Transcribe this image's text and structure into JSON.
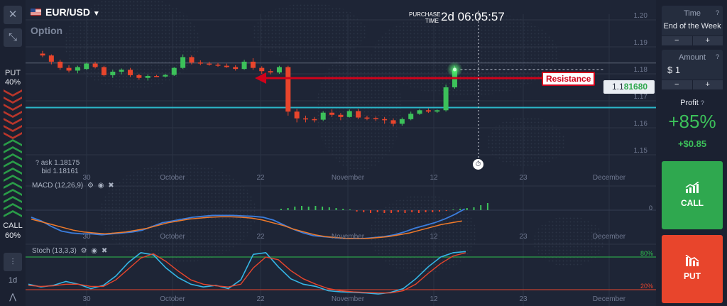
{
  "asset": {
    "name": "EUR/USD",
    "type": "Option"
  },
  "timer": {
    "label_line1": "PURCHASE",
    "label_line2": "TIME",
    "value": "2d 06:05:57"
  },
  "price": {
    "prefix": "1.1",
    "highlight": "81680"
  },
  "quote": {
    "ask": "ask 1.18175",
    "bid": "bid 1.18161"
  },
  "annotation": {
    "label": "Resistance",
    "color": "#d0021b"
  },
  "sentiment": {
    "put_label": "PUT",
    "put_pct": "40%",
    "call_label": "CALL",
    "call_pct": "60%",
    "put_share": 0.4,
    "call_share": 0.6
  },
  "left_toolbar": {
    "close_icon": "close-icon",
    "collapse_icon": "collapse-arrows-icon",
    "chart_type_icon": "candlestick-chart-icon",
    "timeframe": "1d",
    "draw_icon": "drawing-tool-icon"
  },
  "indicators": {
    "macd": {
      "label": "MACD (12,26,9)",
      "zero_label": "0",
      "icons": [
        "gear-icon",
        "eye-icon",
        "close-icon"
      ]
    },
    "stoch": {
      "label": "Stoch (13,3,3)",
      "upper_label": "80%",
      "lower_label": "20%",
      "icons": [
        "gear-icon",
        "eye-icon",
        "close-icon"
      ]
    }
  },
  "right_panel": {
    "time_label": "Time",
    "time_value": "End of the Week",
    "amount_label": "Amount",
    "amount_value": "$ 1",
    "stepper_minus": "−",
    "stepper_plus": "+",
    "profit_label": "Profit",
    "profit_pct": "+85%",
    "profit_value": "+$0.85",
    "call_label": "CALL",
    "put_label": "PUT",
    "call_color": "#2fa84f",
    "put_color": "#e8452c"
  },
  "chart_data": {
    "type": "candlestick",
    "y_ticks": [
      "1.20",
      "1.19",
      "1.18",
      "1.17",
      "1.16",
      "1.15"
    ],
    "x_ticks": [
      "30",
      "October",
      "22",
      "November",
      "12",
      "23",
      "December"
    ],
    "ylim": [
      1.15,
      1.2
    ],
    "candles": [
      {
        "o": 1.1875,
        "h": 1.1885,
        "l": 1.1862,
        "c": 1.1868
      },
      {
        "o": 1.1868,
        "h": 1.1872,
        "l": 1.1835,
        "c": 1.1845
      },
      {
        "o": 1.1845,
        "h": 1.1852,
        "l": 1.1815,
        "c": 1.1822
      },
      {
        "o": 1.1822,
        "h": 1.1832,
        "l": 1.1805,
        "c": 1.1812
      },
      {
        "o": 1.1812,
        "h": 1.183,
        "l": 1.1802,
        "c": 1.1825
      },
      {
        "o": 1.1818,
        "h": 1.1842,
        "l": 1.1815,
        "c": 1.1838
      },
      {
        "o": 1.1838,
        "h": 1.1845,
        "l": 1.182,
        "c": 1.1825
      },
      {
        "o": 1.1825,
        "h": 1.183,
        "l": 1.179,
        "c": 1.1795
      },
      {
        "o": 1.1795,
        "h": 1.1815,
        "l": 1.1785,
        "c": 1.1808
      },
      {
        "o": 1.1808,
        "h": 1.182,
        "l": 1.1798,
        "c": 1.1815
      },
      {
        "o": 1.1815,
        "h": 1.1822,
        "l": 1.1788,
        "c": 1.1795
      },
      {
        "o": 1.1795,
        "h": 1.18,
        "l": 1.1778,
        "c": 1.1785
      },
      {
        "o": 1.1785,
        "h": 1.1798,
        "l": 1.1775,
        "c": 1.1792
      },
      {
        "o": 1.1792,
        "h": 1.1796,
        "l": 1.1788,
        "c": 1.179
      },
      {
        "o": 1.179,
        "h": 1.18,
        "l": 1.1786,
        "c": 1.1796
      },
      {
        "o": 1.1796,
        "h": 1.1825,
        "l": 1.1792,
        "c": 1.1822
      },
      {
        "o": 1.1822,
        "h": 1.1872,
        "l": 1.1818,
        "c": 1.1862
      },
      {
        "o": 1.1862,
        "h": 1.1868,
        "l": 1.1835,
        "c": 1.1842
      },
      {
        "o": 1.1842,
        "h": 1.185,
        "l": 1.1832,
        "c": 1.1838
      },
      {
        "o": 1.1838,
        "h": 1.1845,
        "l": 1.183,
        "c": 1.1834
      },
      {
        "o": 1.1834,
        "h": 1.184,
        "l": 1.1826,
        "c": 1.183
      },
      {
        "o": 1.183,
        "h": 1.1838,
        "l": 1.1822,
        "c": 1.1825
      },
      {
        "o": 1.1825,
        "h": 1.1832,
        "l": 1.1812,
        "c": 1.1818
      },
      {
        "o": 1.1818,
        "h": 1.1852,
        "l": 1.1815,
        "c": 1.1845
      },
      {
        "o": 1.1845,
        "h": 1.1858,
        "l": 1.1815,
        "c": 1.1822
      },
      {
        "o": 1.1822,
        "h": 1.1828,
        "l": 1.18,
        "c": 1.181
      },
      {
        "o": 1.181,
        "h": 1.1818,
        "l": 1.1798,
        "c": 1.1805
      },
      {
        "o": 1.1805,
        "h": 1.183,
        "l": 1.18,
        "c": 1.1825
      },
      {
        "o": 1.1825,
        "h": 1.183,
        "l": 1.1645,
        "c": 1.166
      },
      {
        "o": 1.166,
        "h": 1.167,
        "l": 1.162,
        "c": 1.1635
      },
      {
        "o": 1.1635,
        "h": 1.1645,
        "l": 1.162,
        "c": 1.1632
      },
      {
        "o": 1.1632,
        "h": 1.164,
        "l": 1.162,
        "c": 1.163
      },
      {
        "o": 1.163,
        "h": 1.1662,
        "l": 1.1625,
        "c": 1.1656
      },
      {
        "o": 1.1656,
        "h": 1.1668,
        "l": 1.164,
        "c": 1.1648
      },
      {
        "o": 1.1648,
        "h": 1.1655,
        "l": 1.1628,
        "c": 1.164
      },
      {
        "o": 1.164,
        "h": 1.1668,
        "l": 1.1638,
        "c": 1.1662
      },
      {
        "o": 1.1662,
        "h": 1.167,
        "l": 1.1632,
        "c": 1.1638
      },
      {
        "o": 1.1638,
        "h": 1.1645,
        "l": 1.1628,
        "c": 1.1636
      },
      {
        "o": 1.1636,
        "h": 1.1642,
        "l": 1.1625,
        "c": 1.1632
      },
      {
        "o": 1.1632,
        "h": 1.164,
        "l": 1.1615,
        "c": 1.1628
      },
      {
        "o": 1.1628,
        "h": 1.1635,
        "l": 1.1605,
        "c": 1.1615
      },
      {
        "o": 1.1615,
        "h": 1.1638,
        "l": 1.1608,
        "c": 1.1632
      },
      {
        "o": 1.1632,
        "h": 1.166,
        "l": 1.1628,
        "c": 1.1652
      },
      {
        "o": 1.1652,
        "h": 1.167,
        "l": 1.1648,
        "c": 1.1665
      },
      {
        "o": 1.1665,
        "h": 1.1672,
        "l": 1.1655,
        "c": 1.166
      },
      {
        "o": 1.166,
        "h": 1.1668,
        "l": 1.1655,
        "c": 1.1665
      },
      {
        "o": 1.1665,
        "h": 1.176,
        "l": 1.166,
        "c": 1.175
      },
      {
        "o": 1.175,
        "h": 1.183,
        "l": 1.1745,
        "c": 1.1816
      }
    ],
    "resistance_level": 1.184,
    "support_level": 1.1675,
    "macd_hist": [
      0.0,
      0.0,
      0.0,
      0.0,
      0.0,
      0.0,
      0.0,
      0.0,
      0.0,
      0.0,
      0.0,
      0.0,
      0.0,
      0.0,
      0.0,
      0.0,
      0.0,
      0.2,
      0.3,
      0.5,
      0.6,
      0.5,
      0.6,
      0.5,
      0.4,
      0.3,
      0.2,
      0.1,
      -0.2,
      -0.3,
      -0.4,
      -0.3,
      -0.4,
      -0.4,
      -0.3,
      -0.4,
      -0.3,
      -0.4,
      -0.3,
      -0.3,
      -0.2,
      -0.1,
      0.1,
      0.2,
      0.3,
      0.4,
      0.7,
      1.0
    ],
    "macd_line": [
      0.0,
      -0.4,
      -1.0,
      -1.5,
      -1.7,
      -1.8,
      -1.8,
      -1.9,
      -1.8,
      -1.7,
      -1.6,
      -1.4,
      -1.0,
      -0.6,
      -0.4,
      -0.2,
      0.0,
      0.1,
      0.2,
      0.2,
      0.2,
      0.15,
      0.1,
      0.0,
      -0.3,
      -0.8,
      -1.3,
      -1.7,
      -2.0,
      -2.1,
      -2.2,
      -2.3,
      -2.3,
      -2.3,
      -2.2,
      -2.1,
      -1.9,
      -1.6,
      -1.2,
      -0.9,
      -0.6,
      -0.2,
      0.3,
      0.9
    ],
    "signal_line": [
      -0.2,
      -0.5,
      -0.8,
      -1.1,
      -1.4,
      -1.6,
      -1.7,
      -1.8,
      -1.7,
      -1.6,
      -1.4,
      -1.2,
      -0.9,
      -0.6,
      -0.4,
      -0.2,
      -0.1,
      0.0,
      0.05,
      0.05,
      0.0,
      -0.1,
      -0.3,
      -0.6,
      -0.9,
      -1.3,
      -1.6,
      -1.9,
      -2.1,
      -2.2,
      -2.3,
      -2.3,
      -2.3,
      -2.2,
      -2.1,
      -1.9,
      -1.7,
      -1.4,
      -1.1,
      -0.8,
      -0.6,
      -0.4
    ],
    "stoch_k": [
      30,
      25,
      28,
      35,
      30,
      22,
      28,
      45,
      70,
      88,
      84,
      60,
      42,
      30,
      25,
      28,
      22,
      38,
      85,
      88,
      62,
      40,
      30,
      26,
      18,
      16,
      15,
      14,
      12,
      15,
      22,
      40,
      62,
      80,
      88,
      90
    ],
    "stoch_d": [
      28,
      26,
      27,
      30,
      30,
      26,
      26,
      38,
      58,
      78,
      86,
      72,
      54,
      38,
      30,
      27,
      25,
      30,
      60,
      80,
      75,
      55,
      40,
      30,
      22,
      18,
      16,
      15,
      14,
      14,
      18,
      30,
      50,
      68,
      82,
      88
    ]
  }
}
